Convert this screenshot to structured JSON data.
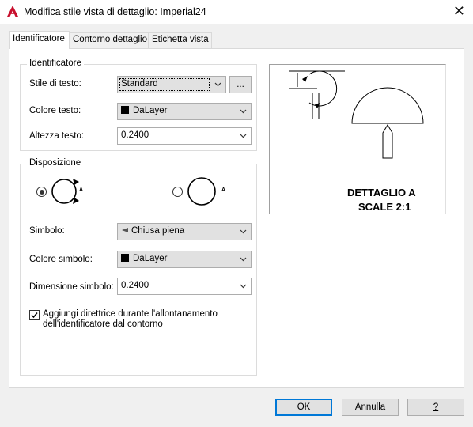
{
  "window": {
    "title": "Modifica stile vista di dettaglio: Imperial24",
    "close_glyph": "✕"
  },
  "tabs": [
    {
      "label": "Identificatore",
      "active": true
    },
    {
      "label": "Contorno dettaglio",
      "active": false
    },
    {
      "label": "Etichetta vista",
      "active": false
    }
  ],
  "identifier_group": {
    "title": "Identificatore",
    "text_style": {
      "label": "Stile di testo:",
      "value": "Standard",
      "browse_label": "..."
    },
    "text_color": {
      "label": "Colore testo:",
      "value": "DaLayer"
    },
    "text_height": {
      "label": "Altezza testo:",
      "value": "0.2400"
    }
  },
  "layout_group": {
    "title": "Disposizione",
    "radio_options": [
      {
        "icon": "circle-with-arrows-icon",
        "letter": "A",
        "selected": true
      },
      {
        "icon": "circle-icon",
        "letter": "A",
        "selected": false
      }
    ],
    "symbol": {
      "label": "Simbolo:",
      "value": "Chiusa piena",
      "icon": "closed-filled-arrow-icon"
    },
    "symbol_color": {
      "label": "Colore simbolo:",
      "value": "DaLayer"
    },
    "symbol_size": {
      "label": "Dimensione simbolo:",
      "value": "0.2400"
    },
    "leader_checkbox": {
      "checked": true,
      "line1": "Aggiungi direttrice durante l'allontanamento",
      "line2": "dell'identificatore dal contorno"
    }
  },
  "preview": {
    "label_line1": "DETTAGLIO A",
    "label_line2": "SCALE 2:1"
  },
  "buttons": {
    "ok": "OK",
    "cancel": "Annulla",
    "help": "?"
  },
  "colors": {
    "accent": "#0078d7",
    "app_icon": "#c8102e",
    "window_bg": "#f0f0f0"
  }
}
